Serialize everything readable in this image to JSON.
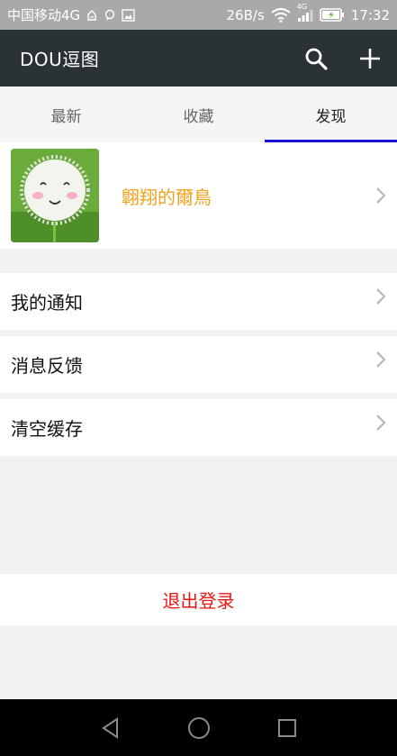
{
  "status_bar": {
    "carrier": "中国移动4G",
    "speed": "26B/s",
    "network": "4G",
    "time": "17:32"
  },
  "app_bar": {
    "title": "DOU逗图",
    "icons": [
      "search-icon",
      "plus-icon"
    ]
  },
  "tabs": [
    {
      "label": "最新",
      "active": false
    },
    {
      "label": "收藏",
      "active": false
    },
    {
      "label": "发现",
      "active": true
    }
  ],
  "profile": {
    "name": "翺翔的爾鳥",
    "name_color": "#f0a21a"
  },
  "menu": {
    "items": [
      {
        "label": "我的通知"
      },
      {
        "label": "消息反馈"
      },
      {
        "label": "清空缓存"
      }
    ]
  },
  "logout": {
    "label": "退出登录",
    "color": "#e8140f"
  },
  "colors": {
    "app_bar": "#2b3236",
    "tab_indicator": "#1b12d6"
  }
}
